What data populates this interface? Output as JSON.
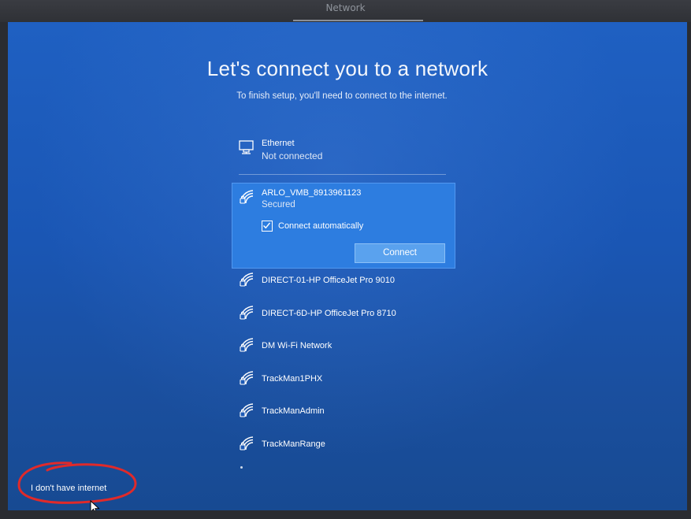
{
  "window": {
    "title": "Network"
  },
  "page": {
    "title": "Let's connect you to a network",
    "subtitle": "To finish setup, you'll need to connect to the internet."
  },
  "ethernet": {
    "name": "Ethernet",
    "status": "Not connected",
    "icon": "ethernet-icon"
  },
  "selected_network": {
    "name": "ARLO_VMB_8913961123",
    "status": "Secured",
    "connect_automatically_label": "Connect automatically",
    "connect_automatically_checked": true,
    "connect_label": "Connect",
    "icon": "wifi-secured-icon"
  },
  "networks": [
    {
      "name": "DIRECT-01-HP OfficeJet Pro 9010",
      "icon": "wifi-secured-icon"
    },
    {
      "name": "DIRECT-6D-HP OfficeJet Pro 8710",
      "icon": "wifi-secured-icon"
    },
    {
      "name": "DM Wi-Fi Network",
      "icon": "wifi-secured-icon"
    },
    {
      "name": "TrackMan1PHX",
      "icon": "wifi-secured-icon"
    },
    {
      "name": "TrackManAdmin",
      "icon": "wifi-secured-icon"
    },
    {
      "name": "TrackManRange",
      "icon": "wifi-secured-icon"
    }
  ],
  "footer": {
    "no_internet_label": "I don't have internet"
  },
  "colors": {
    "background": "#1a56b4",
    "selected_panel": "#2d7de0",
    "button": "#5aa2ee",
    "annotation": "#e02a2a"
  }
}
